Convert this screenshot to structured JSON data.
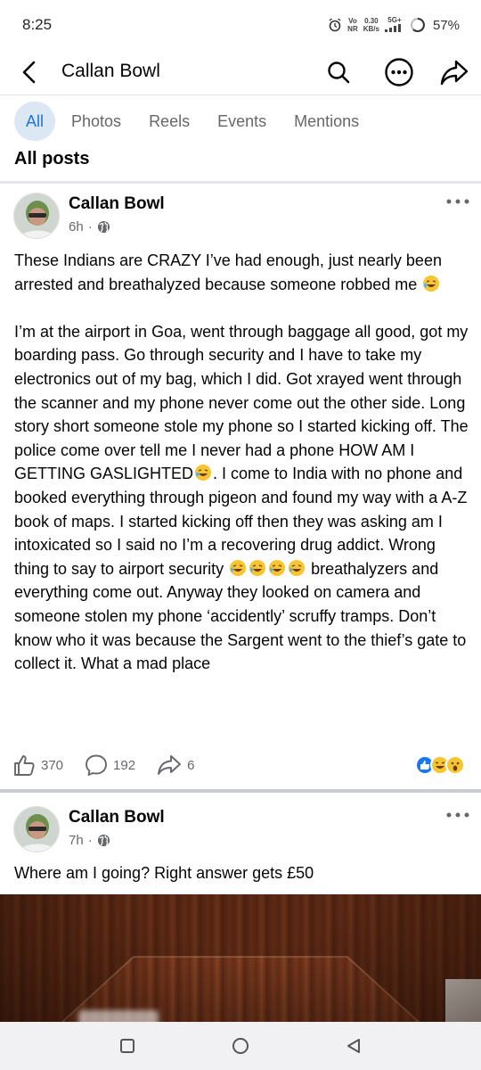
{
  "status_bar": {
    "time": "8:25",
    "network_top": "Vo",
    "network_bottom": "NR",
    "speed_value": "0.30",
    "speed_unit": "KB/s",
    "signal_label": "5G+",
    "battery": "57%"
  },
  "header": {
    "title": "Callan Bowl",
    "icons": [
      "back-arrow-icon",
      "search-icon",
      "more-options-icon",
      "share-icon"
    ]
  },
  "tabs": [
    {
      "label": "All",
      "active": true
    },
    {
      "label": "Photos",
      "active": false
    },
    {
      "label": "Reels",
      "active": false
    },
    {
      "label": "Events",
      "active": false
    },
    {
      "label": "Mentions",
      "active": false
    }
  ],
  "section_heading": "All posts",
  "posts": [
    {
      "author": "Callan Bowl",
      "time": "6h",
      "audience_icon": "globe-icon",
      "text_part1": "These Indians are CRAZY I’ve had enough, just nearly been arrested and breathalyzed because someone robbed me",
      "text_part2": "I’m at the airport in Goa, went through baggage all good, got my boarding pass. Go through security and I have to take my electronics out of my bag, which I did. Got xrayed went through the scanner and my phone never come out the other side. Long story short someone stole my phone so I started kicking off. The police come over tell me I never had a phone HOW AM I GETTING GASLIGHTED",
      "text_part3": ". I come to India with no phone and booked everything through pigeon and found my way with a A-Z book of maps. I started kicking off then they was asking am I intoxicated so I said no I’m a recovering drug addict. Wrong thing to say to airport security",
      "text_part4": " breathalyzers and everything come out. Anyway they looked on camera and someone stolen my phone ‘accidently’ scruffy tramps. Don’t know who it was because the Sargent went to the thief’s gate to collect it. What a mad place",
      "likes": "370",
      "comments": "192",
      "shares": "6",
      "reactions": [
        "like",
        "laugh",
        "wow"
      ]
    },
    {
      "author": "Callan Bowl",
      "time": "7h",
      "audience_icon": "globe-icon",
      "text": "Where am I going? Right answer gets £50"
    }
  ],
  "colors": {
    "accent": "#1b74e4",
    "tab_active_bg": "#dbe7f2",
    "secondary_text": "#65676b",
    "divider": "#c9ccd1"
  }
}
